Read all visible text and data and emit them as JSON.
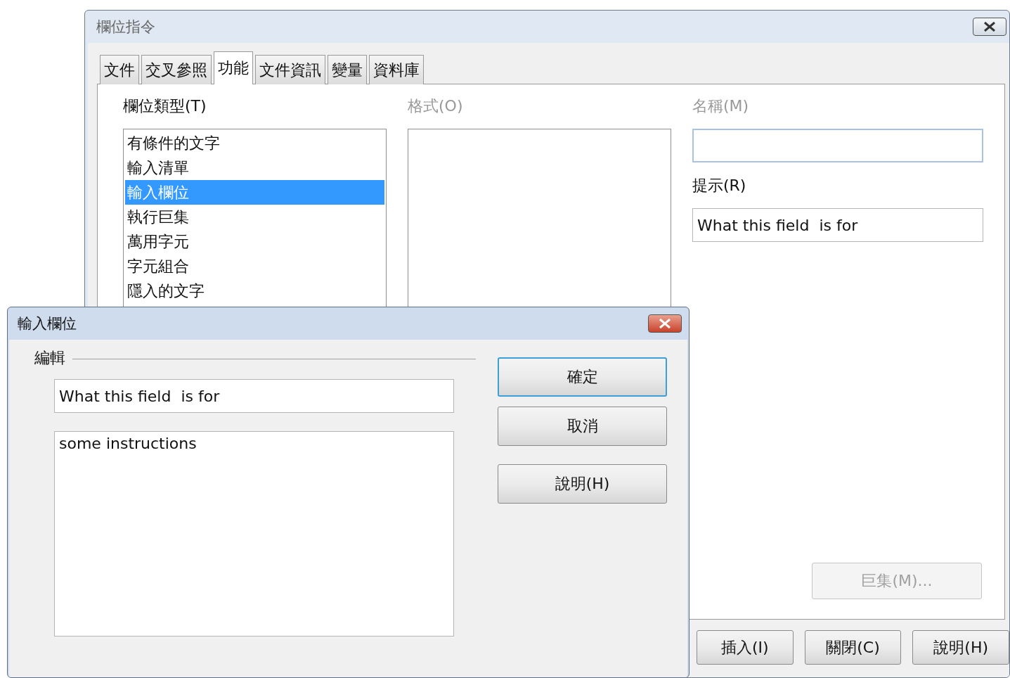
{
  "back_window": {
    "title": "欄位指令",
    "tabs": [
      {
        "label": "文件",
        "selected": false
      },
      {
        "label": "交叉參照",
        "selected": false
      },
      {
        "label": "功能",
        "selected": true
      },
      {
        "label": "文件資訊",
        "selected": false
      },
      {
        "label": "變量",
        "selected": false
      },
      {
        "label": "資料庫",
        "selected": false
      }
    ],
    "field_type": {
      "label": "欄位類型(T)",
      "items": [
        {
          "label": "有條件的文字",
          "selected": false
        },
        {
          "label": "輸入清單",
          "selected": false
        },
        {
          "label": "輸入欄位",
          "selected": true
        },
        {
          "label": "執行巨集",
          "selected": false
        },
        {
          "label": "萬用字元",
          "selected": false
        },
        {
          "label": "字元組合",
          "selected": false
        },
        {
          "label": "隱入的文字",
          "selected": false
        }
      ]
    },
    "format": {
      "label": "格式(O)",
      "disabled": true
    },
    "name": {
      "label": "名稱(M)",
      "disabled": true
    },
    "hint": {
      "label": "提示(R)",
      "disabled": false,
      "value": "What this field  is for"
    },
    "macro_button": {
      "label": "巨集(M)...",
      "disabled": true
    },
    "buttons": [
      "插入(I)",
      "關閉(C)",
      "說明(H)"
    ]
  },
  "front_dialog": {
    "title": "輸入欄位",
    "group_label": "編輯",
    "hint_field": {
      "value": "What this field  is for"
    },
    "text_field": {
      "value": "some instructions"
    },
    "buttons": [
      {
        "label": "確定",
        "default": true
      },
      {
        "label": "取消",
        "default": false
      },
      {
        "label": "說明(H)",
        "default": false
      }
    ]
  }
}
